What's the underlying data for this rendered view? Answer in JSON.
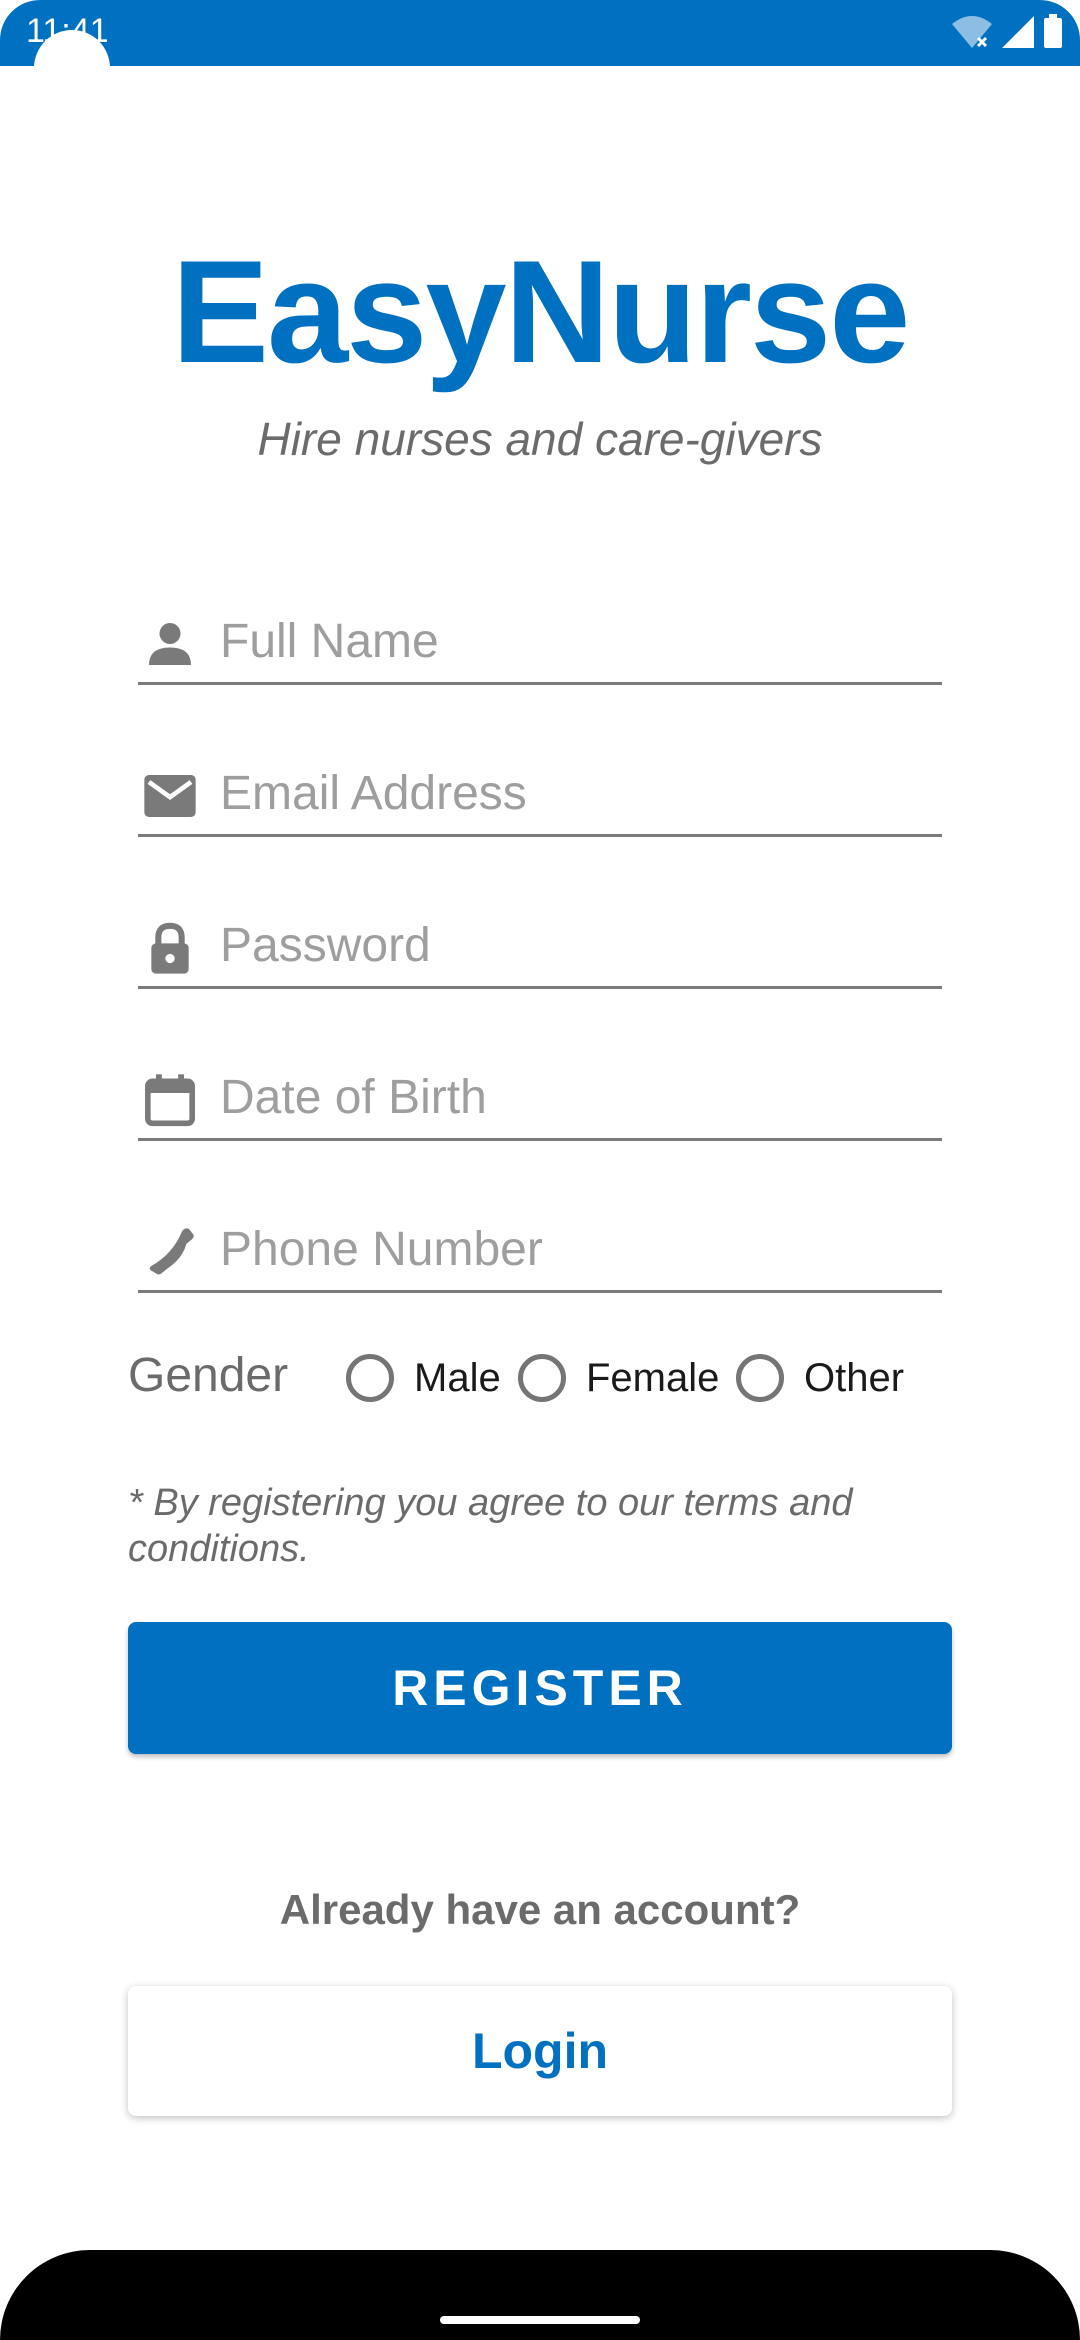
{
  "status_bar": {
    "time": "11:41",
    "icons": [
      "wifi-off-icon",
      "signal-icon",
      "battery-icon"
    ],
    "color": "#0070c0"
  },
  "brand": {
    "title": "EasyNurse",
    "tagline": "Hire nurses and care-givers",
    "color": "#0070c0"
  },
  "form": {
    "fields": [
      {
        "icon": "person-icon",
        "placeholder": "Full Name"
      },
      {
        "icon": "email-icon",
        "placeholder": "Email Address"
      },
      {
        "icon": "lock-icon",
        "placeholder": "Password"
      },
      {
        "icon": "calendar-icon",
        "placeholder": "Date of Birth"
      },
      {
        "icon": "phone-icon",
        "placeholder": "Phone Number"
      }
    ],
    "gender": {
      "label": "Gender",
      "options": [
        "Male",
        "Female",
        "Other"
      ]
    },
    "terms": "* By registering you agree to our terms and conditions.",
    "register_label": "REGISTER"
  },
  "login": {
    "prompt": "Already have an account?",
    "button_label": "Login"
  }
}
